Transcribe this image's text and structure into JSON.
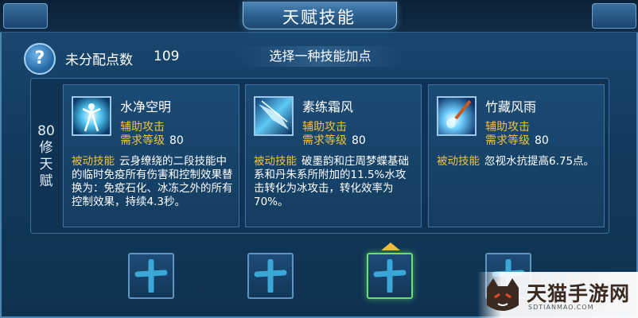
{
  "window": {
    "title": "天赋技能"
  },
  "header": {
    "unallocated_label": "未分配点数",
    "unallocated_value": "109",
    "hint": "选择一种技能加点",
    "help_icon_glyph": "?"
  },
  "tier": {
    "label_lines": [
      "80",
      "修",
      "天",
      "赋"
    ]
  },
  "skills": [
    {
      "name": "水净空明",
      "type": "辅助攻击",
      "req_label": "需求等级",
      "req_value": "80",
      "desc_tag": "被动技能",
      "desc": "云身缭绕的二段技能中的临时免疫所有伤害和控制效果替换为：免疫石化、冰冻之外的所有控制效果，持续4.3秒。",
      "icon": "water-figure-icon"
    },
    {
      "name": "素练霜风",
      "type": "辅助攻击",
      "req_label": "需求等级",
      "req_value": "80",
      "desc_tag": "被动技能",
      "desc": "破墨韵和庄周梦蝶基础系和丹朱系所附加的11.5%水攻击转化为冰攻击，转化效率为70%。",
      "icon": "frost-wind-icon"
    },
    {
      "name": "竹藏风雨",
      "type": "辅助攻击",
      "req_label": "需求等级",
      "req_value": "80",
      "desc_tag": "被动技能",
      "desc": "忽视水抗提高6.75点。",
      "icon": "brush-strike-icon"
    }
  ],
  "slots": [
    {
      "icon": "plus-icon",
      "selected": false
    },
    {
      "icon": "plus-icon",
      "selected": false
    },
    {
      "icon": "plus-icon",
      "selected": true
    },
    {
      "icon": "plus-icon",
      "selected": false
    }
  ],
  "watermark": {
    "text": "天猫手游网",
    "sub": "SDTIANMAO.COM"
  },
  "colors": {
    "accent_gold": "#f0c246",
    "selected_green": "#6be06b",
    "panel_blue": "#143d60"
  }
}
